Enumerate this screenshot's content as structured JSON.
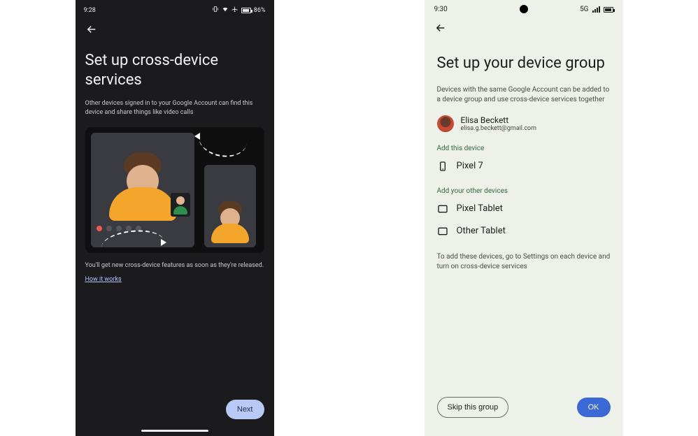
{
  "left": {
    "status": {
      "time": "9:28",
      "battery": "86%"
    },
    "title": "Set up cross-device services",
    "subtitle": "Other devices signed in to your Google Account can find this device and share things like video calls",
    "footnote": "You'll get new cross-device features as soon as they're released.",
    "how_link": "How it works",
    "next_label": "Next"
  },
  "right": {
    "status": {
      "time": "9:30",
      "net": "5G"
    },
    "title": "Set up your device group",
    "subtitle": "Devices with the same Google Account can be added to a device group and use cross-device services together",
    "account": {
      "name": "Elisa Beckett",
      "email": "elisa.g.beckett@gmail.com"
    },
    "section_this": "Add this device",
    "this_device": "Pixel 7",
    "section_other": "Add your other devices",
    "other_devices": [
      "Pixel Tablet",
      "Other Tablet"
    ],
    "footnote": "To add these devices, go to Settings on each device and turn on cross-device services",
    "skip_label": "Skip this group",
    "ok_label": "OK"
  }
}
